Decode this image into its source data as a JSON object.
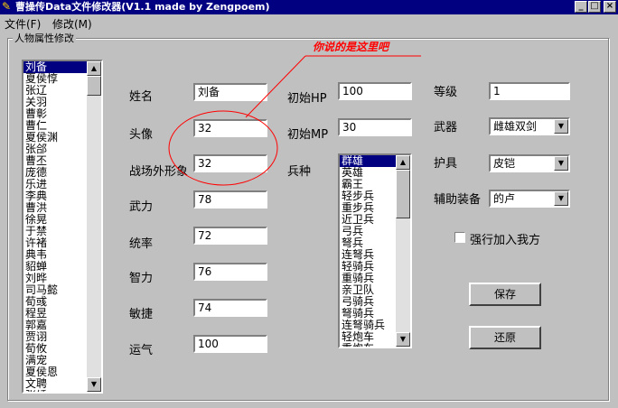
{
  "window": {
    "title": "曹操传Data文件修改器(V1.1 made by Zengpoem)",
    "buttons": [
      "_",
      "□",
      "×"
    ]
  },
  "menu": [
    "文件(F)",
    "修改(M)"
  ],
  "group": {
    "caption": "人物属性修改"
  },
  "characters": {
    "selected": "刘备",
    "items": [
      "刘备",
      "夏侯惇",
      "张辽",
      "关羽",
      "曹彰",
      "曹仁",
      "夏侯渊",
      "张郃",
      "曹丕",
      "庞德",
      "乐进",
      "李典",
      "曹洪",
      "徐晃",
      "于禁",
      "许褚",
      "典韦",
      "貂蝉",
      "刘晔",
      "司马懿",
      "荀彧",
      "程昱",
      "郭嘉",
      "贾诩",
      "荀攸",
      "满宠",
      "夏侯恩",
      "文聘",
      "张绣"
    ]
  },
  "fields": {
    "name": {
      "label": "姓名",
      "value": "刘备"
    },
    "portrait": {
      "label": "头像",
      "value": "32"
    },
    "field_image": {
      "label": "战场外形象",
      "value": "32"
    },
    "strength": {
      "label": "武力",
      "value": "78"
    },
    "command": {
      "label": "统率",
      "value": "72"
    },
    "intelligence": {
      "label": "智力",
      "value": "76"
    },
    "agility": {
      "label": "敏捷",
      "value": "74"
    },
    "luck": {
      "label": "运气",
      "value": "100"
    },
    "init_hp": {
      "label": "初始HP",
      "value": "100"
    },
    "init_mp": {
      "label": "初始MP",
      "value": "30"
    },
    "level": {
      "label": "等级",
      "value": "1"
    }
  },
  "troops": {
    "label": "兵种",
    "selected": "群雄",
    "items": [
      "群雄",
      "英雄",
      "霸王",
      "轻步兵",
      "重步兵",
      "近卫兵",
      "弓兵",
      "弩兵",
      "连弩兵",
      "轻骑兵",
      "重骑兵",
      "亲卫队",
      "弓骑兵",
      "弩骑兵",
      "连弩骑兵",
      "轻炮车",
      "重炮车"
    ]
  },
  "equipment": {
    "weapon": {
      "label": "武器",
      "value": "雌雄双剑"
    },
    "armor": {
      "label": "护具",
      "value": "皮铠"
    },
    "accessory": {
      "label": "辅助装备",
      "value": "的卢"
    }
  },
  "force_join": {
    "label": "强行加入我方",
    "checked": false
  },
  "actions": {
    "save": "保存",
    "restore": "还原"
  },
  "annotation": {
    "text": "你说的是这里吧",
    "color": "#ff0000"
  },
  "colors": {
    "titlebar": "#000080",
    "selection": "#000080",
    "face": "#c0c0c0"
  }
}
